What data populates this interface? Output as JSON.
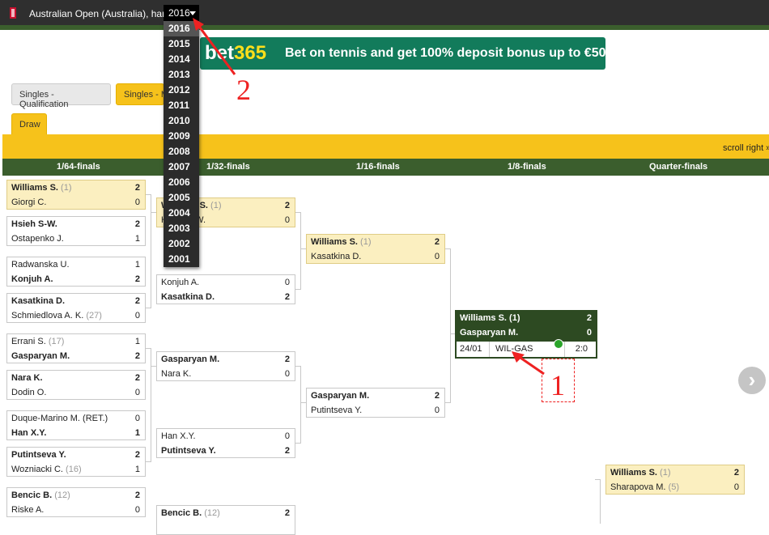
{
  "header": {
    "title": "Australian Open (Australia), hard",
    "year_selected": "2016",
    "year_options": [
      "2016",
      "2015",
      "2014",
      "2013",
      "2012",
      "2011",
      "2010",
      "2009",
      "2008",
      "2007",
      "2006",
      "2005",
      "2004",
      "2003",
      "2002",
      "2001"
    ]
  },
  "ad": {
    "logo_prefix": "bet",
    "logo_suffix": "365",
    "text": "Bet on tennis and get 100% deposit bonus up to €50"
  },
  "tabs": {
    "qualification": "Singles - Qualification",
    "singles": "Singles - Main",
    "draw": "Draw"
  },
  "scroll_hint": "scroll right »",
  "rounds": [
    "1/64-finals",
    "1/32-finals",
    "1/16-finals",
    "1/8-finals",
    "Quarter-finals"
  ],
  "matches": {
    "r64": [
      {
        "p1": "Williams S.",
        "s1": "(1)",
        "sc1": "2",
        "p2": "Giorgi C.",
        "s2": "",
        "sc2": "0",
        "w": 1,
        "hl": true
      },
      {
        "p1": "Hsieh S-W.",
        "s1": "",
        "sc1": "2",
        "p2": "Ostapenko J.",
        "s2": "",
        "sc2": "1",
        "w": 1
      },
      {
        "p1": "Radwanska U.",
        "s1": "",
        "sc1": "1",
        "p2": "Konjuh A.",
        "s2": "",
        "sc2": "2",
        "w": 2
      },
      {
        "p1": "Kasatkina D.",
        "s1": "",
        "sc1": "2",
        "p2": "Schmiedlova A. K.",
        "s2": "(27)",
        "sc2": "0",
        "w": 1
      },
      {
        "p1": "Errani S.",
        "s1": "(17)",
        "sc1": "1",
        "p2": "Gasparyan M.",
        "s2": "",
        "sc2": "2",
        "w": 2
      },
      {
        "p1": "Nara K.",
        "s1": "",
        "sc1": "2",
        "p2": "Dodin O.",
        "s2": "",
        "sc2": "0",
        "w": 1
      },
      {
        "p1": "Duque-Marino M. (RET.)",
        "s1": "",
        "sc1": "0",
        "p2": "Han X.Y.",
        "s2": "",
        "sc2": "1",
        "w": 2
      },
      {
        "p1": "Putintseva Y.",
        "s1": "",
        "sc1": "2",
        "p2": "Wozniacki C.",
        "s2": "(16)",
        "sc2": "1",
        "w": 1
      },
      {
        "p1": "Bencic B.",
        "s1": "(12)",
        "sc1": "2",
        "p2": "Riske A.",
        "s2": "",
        "sc2": "0",
        "w": 1
      }
    ],
    "r32": [
      {
        "p1": "Williams S.",
        "s1": "(1)",
        "sc1": "2",
        "p2": "Hsieh S-W.",
        "s2": "",
        "sc2": "0",
        "w": 1,
        "hl": true
      },
      {
        "p1": "Konjuh A.",
        "s1": "",
        "sc1": "0",
        "p2": "Kasatkina D.",
        "s2": "",
        "sc2": "2",
        "w": 2
      },
      {
        "p1": "Gasparyan M.",
        "s1": "",
        "sc1": "2",
        "p2": "Nara K.",
        "s2": "",
        "sc2": "0",
        "w": 1
      },
      {
        "p1": "Han X.Y.",
        "s1": "",
        "sc1": "0",
        "p2": "Putintseva Y.",
        "s2": "",
        "sc2": "2",
        "w": 2
      },
      {
        "p1": "Bencic B.",
        "s1": "(12)",
        "sc1": "2",
        "p2": "",
        "s2": "",
        "sc2": "",
        "w": 1
      }
    ],
    "r16": [
      {
        "p1": "Williams S.",
        "s1": "(1)",
        "sc1": "2",
        "p2": "Kasatkina D.",
        "s2": "",
        "sc2": "0",
        "w": 1,
        "hl": true
      },
      {
        "p1": "Gasparyan M.",
        "s1": "",
        "sc1": "2",
        "p2": "Putintseva Y.",
        "s2": "",
        "sc2": "0",
        "w": 1
      }
    ],
    "r8": {
      "p1": "Williams S.",
      "s1": "(1)",
      "sc1": "2",
      "p2": "Gasparyan M.",
      "s2": "",
      "sc2": "0",
      "date": "24/01",
      "code": "WIL-GAS",
      "result": "2:0"
    },
    "qf": [
      {
        "p1": "Williams S.",
        "s1": "(1)",
        "sc1": "2",
        "p2": "Sharapova M.",
        "s2": "(5)",
        "sc2": "0",
        "w": 1,
        "hl": true
      }
    ]
  },
  "annotations": {
    "label_1": "1",
    "label_2": "2"
  },
  "icons": {
    "flag": "flag-icon",
    "next": "chevron-right-icon",
    "dropdown": "caret-down-icon"
  },
  "colors": {
    "header_green": "#3b5e2d",
    "accent_yellow": "#f6c21b",
    "highlight_bg": "#fbefc0",
    "annotation_red": "#e22"
  }
}
